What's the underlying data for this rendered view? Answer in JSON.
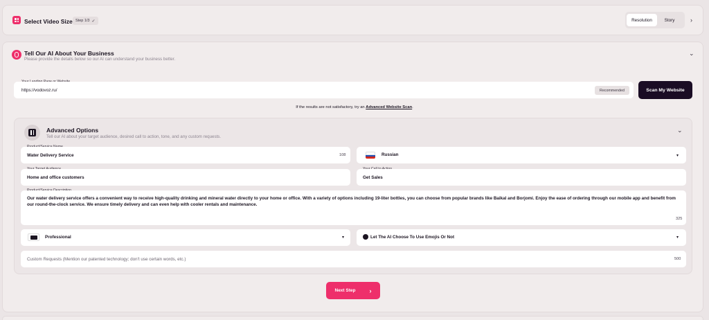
{
  "video_size": {
    "title": "Select Video Size",
    "step": "Step 1/3",
    "step_check": "✓",
    "tabs": [
      "Resolution",
      "Story"
    ],
    "chevron": "›"
  },
  "ai_section": {
    "title": "Tell Our AI About Your Business",
    "subtitle": "Please provide the details below so our AI can understand your business better.",
    "chevron": "⌄",
    "website_label": "Your Landing Page or Website",
    "website_value": "https://vodovoz.ru/",
    "recommended": "Recommended",
    "scan_button": "Scan My Website",
    "hint_prefix": "If the results are not satisfactory, try an ",
    "hint_link": "Advanced Website Scan",
    "hint_suffix": "."
  },
  "advanced": {
    "title": "Advanced Options",
    "subtitle": "Tell our AI about your target audience, desired call to action, tone, and any custom requests.",
    "chevron": "⌄",
    "product_label": "Product/Service Name",
    "product_value": "Water Delivery Service",
    "product_count": "108",
    "language_value": "Russian",
    "audience_label": "Your Target Audience",
    "audience_value": "Home and office customers",
    "cta_label": "Your Call to Action",
    "cta_value": "Get Sales",
    "description_label": "Product/Service Description",
    "description_value": "Our water delivery service offers a convenient way to receive high-quality drinking and mineral water directly to your home or office. With a variety of options including 19-liter bottles, you can choose from popular brands like Baikal and Borjomi. Enjoy the ease of ordering through our mobile app and benefit from our round-the-clock service. We ensure timely delivery and can even help with cooler rentals and maintenance.",
    "description_count": "325",
    "tone_value": "Professional",
    "emoji_value": "Let The AI Choose To Use Emojis Or Not",
    "custom_placeholder": "Custom Requests (Mention our patented technology; don't use certain words, etc.)",
    "custom_count": "500",
    "dropdown_caret": "▾"
  },
  "next_button": {
    "label": "Next Step",
    "arrow": "›"
  },
  "colors": {
    "accent": "#ee2f6b",
    "dark_button": "#1a0c24",
    "background": "#ebe5e6"
  },
  "icons": [
    "grid-icon",
    "ai-logo-icon",
    "sliders-icon",
    "russia-flag-icon",
    "briefcase-icon",
    "emoji-icon",
    "chevron-down-icon",
    "chevron-right-icon"
  ]
}
